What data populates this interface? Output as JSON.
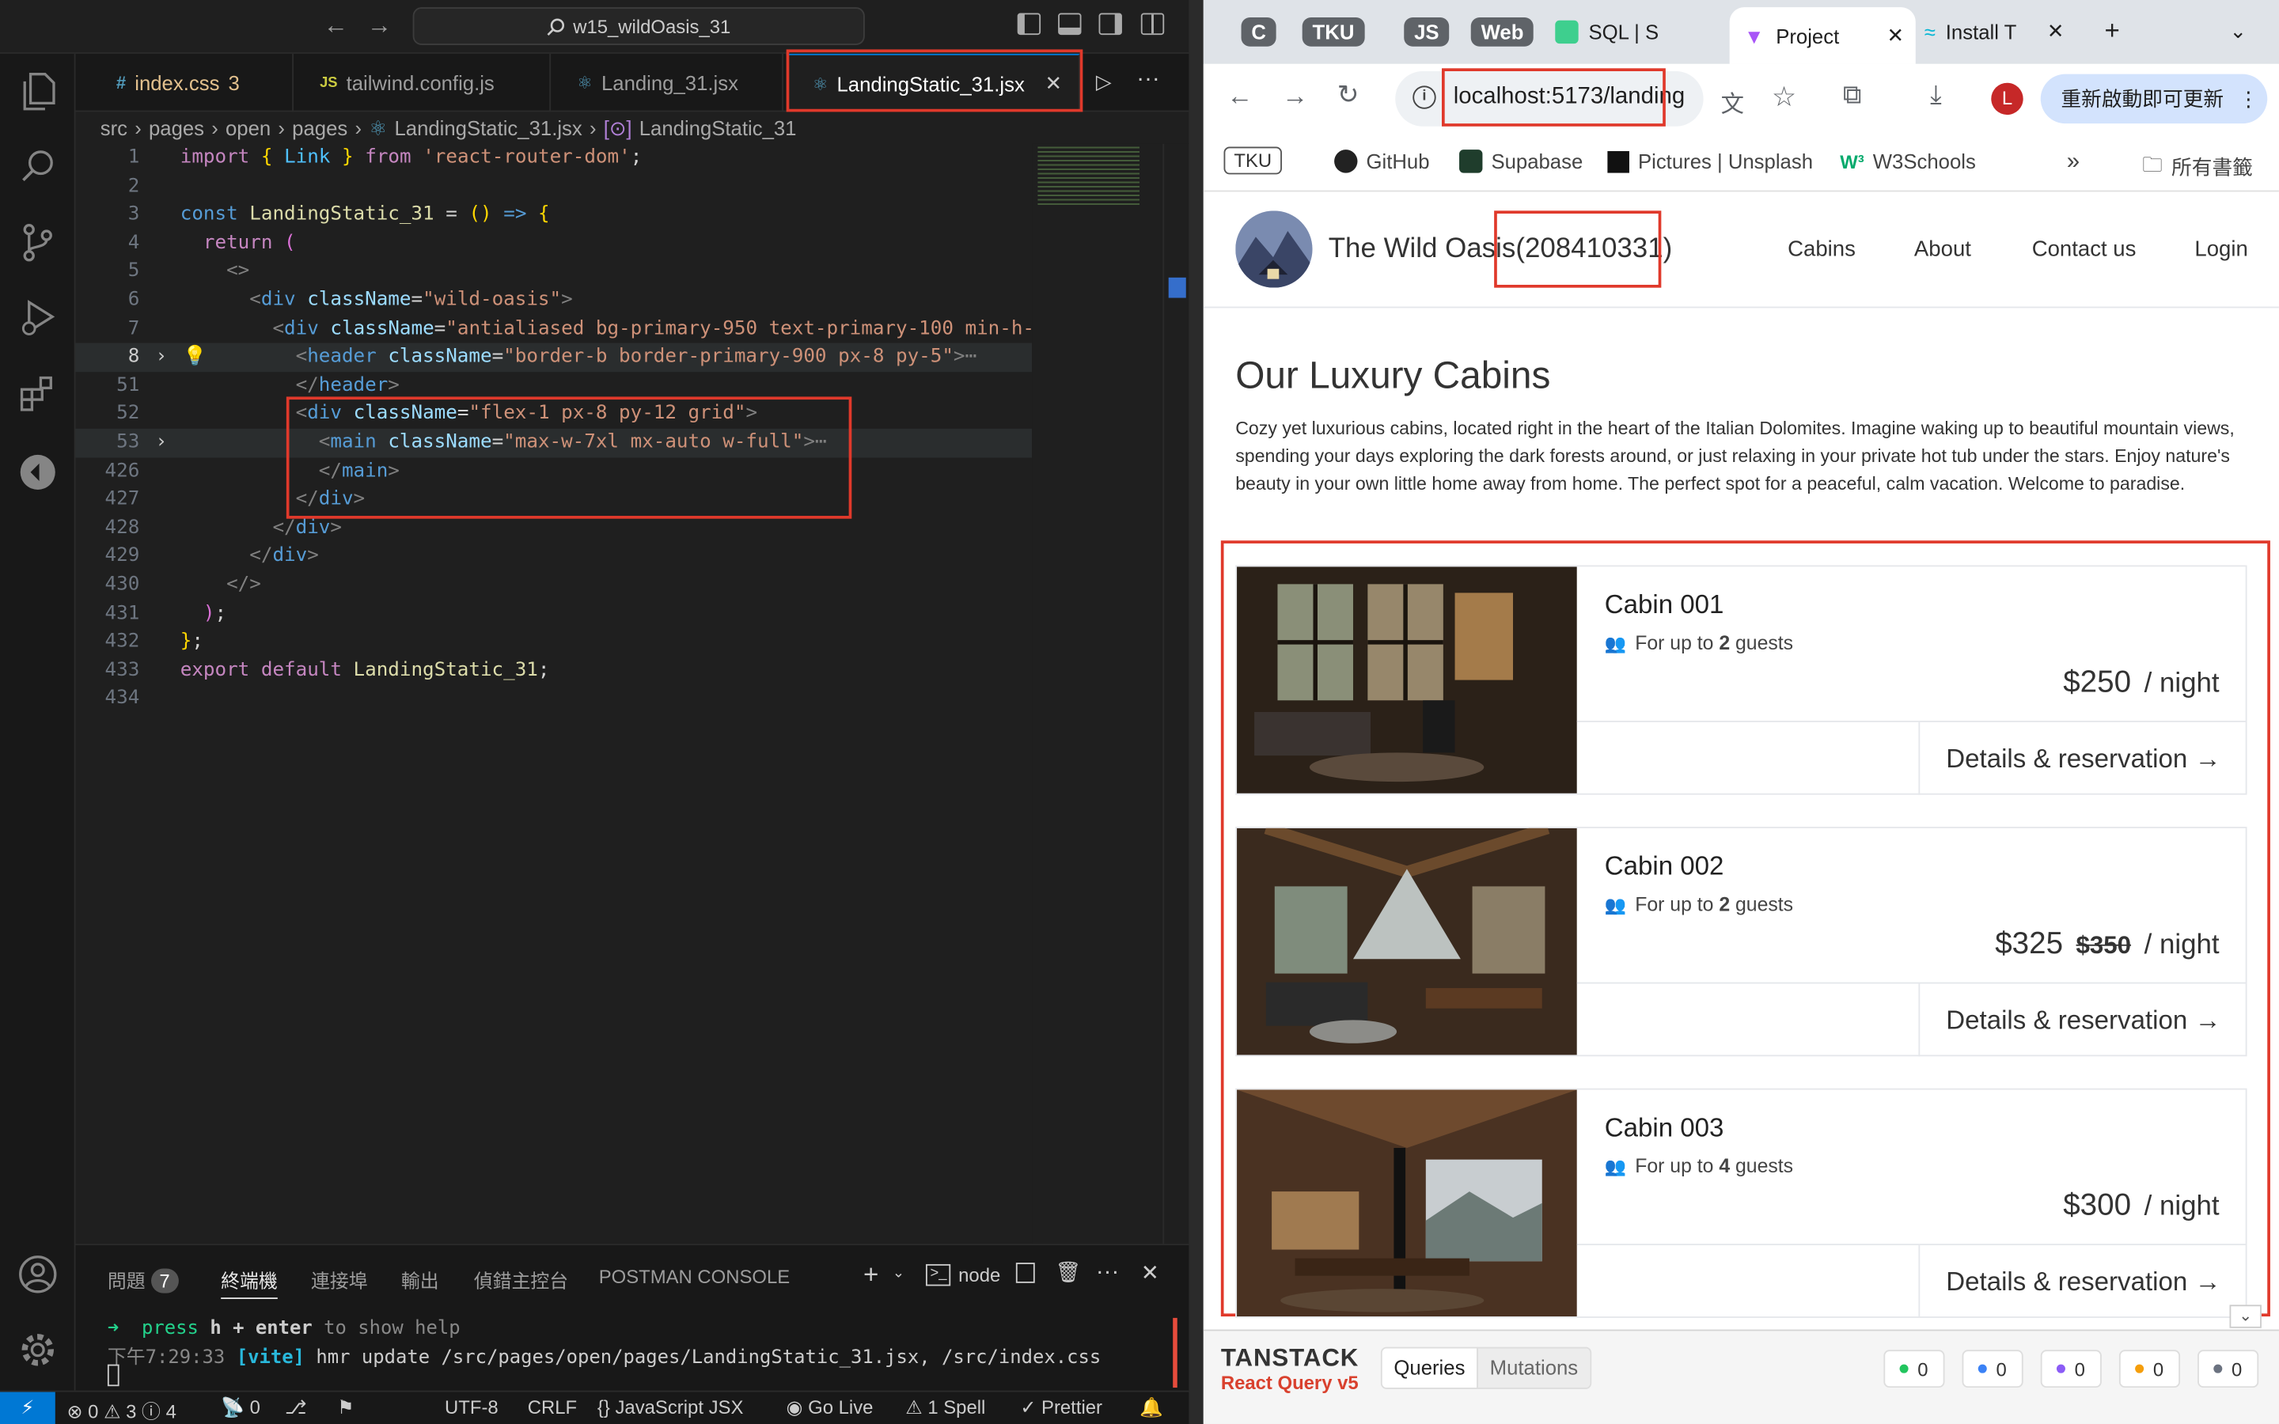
{
  "vscode": {
    "search_title": "w15_wildOasis_31",
    "tabs": [
      {
        "icon": "#",
        "label": "index.css",
        "badge": "3"
      },
      {
        "icon": "JS",
        "label": "tailwind.config.js"
      },
      {
        "icon": "⚛",
        "label": "Landing_31.jsx"
      },
      {
        "icon": "⚛",
        "label": "LandingStatic_31.jsx"
      }
    ],
    "breadcrumb": [
      "src",
      "pages",
      "open",
      "pages",
      "LandingStatic_31.jsx",
      "LandingStatic_31"
    ],
    "line_numbers": [
      "1",
      "2",
      "3",
      "4",
      "5",
      "6",
      "7",
      "8",
      "51",
      "52",
      "53",
      "426",
      "427",
      "428",
      "429",
      "430",
      "431",
      "432",
      "433",
      "434"
    ],
    "panel": {
      "tabs": [
        "問題",
        "終端機",
        "連接埠",
        "輸出",
        "偵錯主控台",
        "POSTMAN CONSOLE"
      ],
      "problems_count": "7",
      "terminal_name": "node",
      "terminal_line1_prefix": "➜  press ",
      "terminal_line1_key": "h + enter",
      "terminal_line1_suffix": " to show help",
      "terminal_line2_time": "下午7:29:33",
      "terminal_line2_tag": "[vite]",
      "terminal_line2_msg": " hmr update /src/pages/open/pages/LandingStatic_31.jsx, /src/index.css"
    },
    "status": {
      "errors": "0",
      "warnings": "3",
      "infos": "4",
      "ports": "0",
      "encoding": "UTF-8",
      "eol": "CRLF",
      "language": "JavaScript JSX",
      "golive": "Go Live",
      "spell": "1 Spell",
      "prettier": "Prettier"
    }
  },
  "browser": {
    "tabs": [
      {
        "label": "C"
      },
      {
        "label": "TKU"
      },
      {
        "label": "JS"
      },
      {
        "label": "Web"
      },
      {
        "label": "SQL | S"
      },
      {
        "label": "Project"
      },
      {
        "label": "Install T"
      }
    ],
    "url": "localhost:5173/landing",
    "update_button": "重新啟動即可更新",
    "profile_initial": "L",
    "bookmarks": [
      "TKU",
      "GitHub",
      "Supabase",
      "Pictures | Unsplash",
      "W3Schools"
    ],
    "all_bookmarks": "所有書籤"
  },
  "site": {
    "brand": "The Wild Oasis",
    "student_id": "(208410331)",
    "nav": [
      "Cabins",
      "About",
      "Contact us",
      "Login"
    ],
    "heading": "Our Luxury Cabins",
    "intro": "Cozy yet luxurious cabins, located right in the heart of the Italian Dolomites. Imagine waking up to beautiful mountain views, spending your days exploring the dark forests around, or just relaxing in your private hot tub under the stars. Enjoy nature's beauty in your own little home away from home. The perfect spot for a peaceful, calm vacation. Welcome to paradise.",
    "cabins": [
      {
        "name": "Cabin 001",
        "guests_prefix": "For up to ",
        "guests": "2",
        "guests_suffix": " guests",
        "price": "$250",
        "old_price": "",
        "unit": "/ night",
        "cta": "Details & reservation →"
      },
      {
        "name": "Cabin 002",
        "guests_prefix": "For up to ",
        "guests": "2",
        "guests_suffix": " guests",
        "price": "$325",
        "old_price": "$350",
        "unit": "/ night",
        "cta": "Details & reservation →"
      },
      {
        "name": "Cabin 003",
        "guests_prefix": "For up to ",
        "guests": "4",
        "guests_suffix": " guests",
        "price": "$300",
        "old_price": "",
        "unit": "/ night",
        "cta": "Details & reservation →"
      }
    ]
  },
  "devtools": {
    "brand": "TANSTACK",
    "sub": "React Query v5",
    "tabs": [
      "Queries",
      "Mutations"
    ],
    "badges": [
      {
        "count": "0",
        "color": "#22c55e"
      },
      {
        "count": "0",
        "color": "#3b82f6"
      },
      {
        "count": "0",
        "color": "#8b5cf6"
      },
      {
        "count": "0",
        "color": "#f59e0b"
      },
      {
        "count": "0",
        "color": "#6b7280"
      }
    ]
  }
}
